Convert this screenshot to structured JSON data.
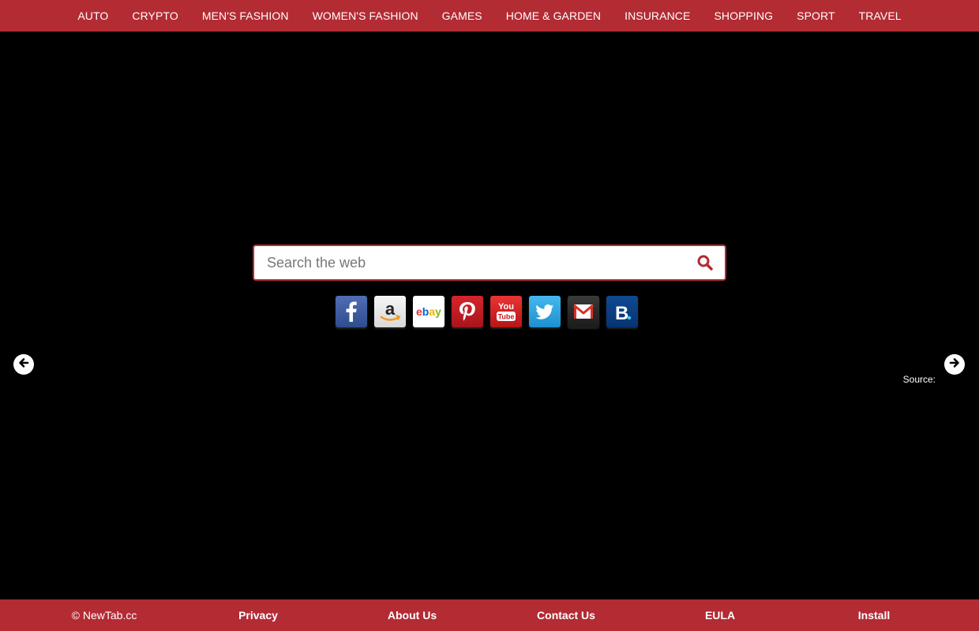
{
  "nav": {
    "items": [
      {
        "label": "AUTO"
      },
      {
        "label": "CRYPTO"
      },
      {
        "label": "MEN'S FASHION"
      },
      {
        "label": "WOMEN'S FASHION"
      },
      {
        "label": "GAMES"
      },
      {
        "label": "HOME & GARDEN"
      },
      {
        "label": "INSURANCE"
      },
      {
        "label": "SHOPPING"
      },
      {
        "label": "SPORT"
      },
      {
        "label": "TRAVEL"
      }
    ]
  },
  "search": {
    "placeholder": "Search the web",
    "icon": "search-icon"
  },
  "shortcuts": [
    {
      "name": "facebook-icon"
    },
    {
      "name": "amazon-icon"
    },
    {
      "name": "ebay-icon",
      "text": "ebay"
    },
    {
      "name": "pinterest-icon"
    },
    {
      "name": "youtube-icon"
    },
    {
      "name": "twitter-icon"
    },
    {
      "name": "gmail-icon"
    },
    {
      "name": "booking-icon"
    }
  ],
  "slideshow": {
    "prev_icon": "arrow-left-icon",
    "next_icon": "arrow-right-icon",
    "source_label": "Source:"
  },
  "footer": {
    "copyright": "© NewTab.cc",
    "privacy": "Privacy",
    "about": "About Us",
    "contact": "Contact Us",
    "eula": "EULA",
    "install": "Install"
  },
  "colors": {
    "accent": "#b32b33",
    "background": "#000000"
  }
}
